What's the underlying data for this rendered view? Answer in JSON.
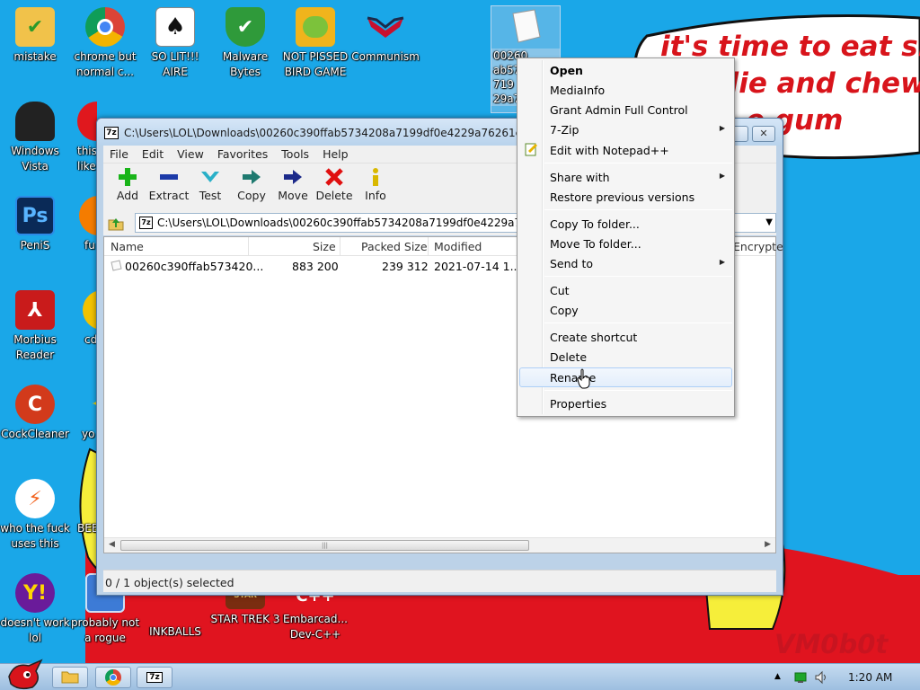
{
  "wallpaper": {
    "text_line1": "it's time to eat shit",
    "text_line2": "die and chew",
    "text_line3": "e gum",
    "signature": "VM0b0t",
    "colors": {
      "sky": "#1aa7e8",
      "red": "#e0141f",
      "yellow": "#f6ee3a"
    }
  },
  "desktop_icons": [
    {
      "name": "mistake",
      "label": "mistake",
      "icon": "folder-check-icon"
    },
    {
      "name": "chrome",
      "label": "chrome but normal c...",
      "icon": "chrome-icon"
    },
    {
      "name": "solit",
      "label": "SO LIT!!! AIRE",
      "icon": "solitaire-icon"
    },
    {
      "name": "malware",
      "label": "Malware Bytes",
      "icon": "shield-icon"
    },
    {
      "name": "pissed-bird",
      "label": "NOT PISSED BIRD GAME",
      "icon": "pig-icon"
    },
    {
      "name": "communism",
      "label": "Communism",
      "icon": "emblem-icon"
    },
    {
      "name": "selected-file",
      "label": "00260c390ffab5734208a7199df0e4229a76261c3f",
      "label_visible": "00260...\nab57...\n719...\n29a7...",
      "icon": "document-icon"
    },
    {
      "name": "windows-vista",
      "label": "Windows Vista",
      "icon": "trash-bin-icon"
    },
    {
      "name": "this-like",
      "label": "this like",
      "icon": "opera-icon"
    },
    {
      "name": "penis",
      "label": "PeniS",
      "icon": "photoshop-icon"
    },
    {
      "name": "fu",
      "label": "fu",
      "icon": "firefox-icon"
    },
    {
      "name": "morbius",
      "label": "Morbius Reader",
      "icon": "pdf-icon"
    },
    {
      "name": "cd",
      "label": "cd",
      "icon": "disc-icon"
    },
    {
      "name": "cockcleaner",
      "label": "CockCleaner",
      "icon": "broom-icon"
    },
    {
      "name": "yo",
      "label": "yo",
      "icon": "star-icon"
    },
    {
      "name": "who-uses",
      "label": "who the fuck uses this",
      "icon": "lightning-icon"
    },
    {
      "name": "bee",
      "label": "BEE",
      "icon": "bee-icon"
    },
    {
      "name": "doesnt-work",
      "label": "doesn't work lol",
      "icon": "yahoo-icon"
    },
    {
      "name": "rogue",
      "label": "probably not a rogue",
      "icon": "monitor-icon"
    },
    {
      "name": "inkballs",
      "label": "INKBALLS",
      "icon": "ink-icon"
    },
    {
      "name": "star-trek",
      "label": "STAR TREK 3",
      "icon": "star-trek-icon"
    },
    {
      "name": "devcpp",
      "label": "Embarcad... Dev-C++",
      "icon": "cpp-icon"
    }
  ],
  "window": {
    "title": "C:\\Users\\LOL\\Downloads\\00260c390ffab5734208a7199df0e4229a76261c3f5",
    "menu": [
      "File",
      "Edit",
      "View",
      "Favorites",
      "Tools",
      "Help"
    ],
    "toolbar": [
      {
        "label": "Add",
        "icon": "plus-icon",
        "color": "#19b419"
      },
      {
        "label": "Extract",
        "icon": "minus-icon",
        "color": "#1c3aa8"
      },
      {
        "label": "Test",
        "icon": "check-icon",
        "color": "#2ab0c8"
      },
      {
        "label": "Copy",
        "icon": "copy-arrow-icon",
        "color": "#1f7a70"
      },
      {
        "label": "Move",
        "icon": "move-arrow-icon",
        "color": "#1c2a8a"
      },
      {
        "label": "Delete",
        "icon": "x-icon",
        "color": "#e01010"
      },
      {
        "label": "Info",
        "icon": "info-icon",
        "color": "#d9b800"
      }
    ],
    "address": "C:\\Users\\LOL\\Downloads\\00260c390ffab5734208a7199df0e4229a7626",
    "columns": [
      "Name",
      "Size",
      "Packed Size",
      "Modified",
      "Encrypte"
    ],
    "files": [
      {
        "name": "00260c390ffab573420...",
        "size": "883 200",
        "packed": "239 312",
        "modified": "2021-07-14 1..."
      }
    ],
    "status": "0 / 1 object(s) selected"
  },
  "context_menu": {
    "items": [
      {
        "label": "Open",
        "bold": true
      },
      {
        "label": "MediaInfo"
      },
      {
        "label": "Grant Admin Full Control"
      },
      {
        "label": "7-Zip",
        "submenu": true
      },
      {
        "label": "Edit with Notepad++",
        "icon": "notepad-icon"
      },
      {
        "sep": true
      },
      {
        "label": "Share with",
        "submenu": true
      },
      {
        "label": "Restore previous versions"
      },
      {
        "sep": true
      },
      {
        "label": "Copy To folder..."
      },
      {
        "label": "Move To folder..."
      },
      {
        "label": "Send to",
        "submenu": true
      },
      {
        "sep": true
      },
      {
        "label": "Cut"
      },
      {
        "label": "Copy"
      },
      {
        "sep": true
      },
      {
        "label": "Create shortcut"
      },
      {
        "label": "Delete"
      },
      {
        "label": "Rename",
        "hover": true
      },
      {
        "sep": true
      },
      {
        "label": "Properties"
      }
    ]
  },
  "taskbar": {
    "clock": "1:20 AM",
    "buttons": [
      {
        "name": "explorer",
        "icon": "folder-icon"
      },
      {
        "name": "chrome",
        "icon": "chrome-icon"
      },
      {
        "name": "7zip",
        "icon": "7zip-icon",
        "glyph": "7z"
      }
    ]
  }
}
